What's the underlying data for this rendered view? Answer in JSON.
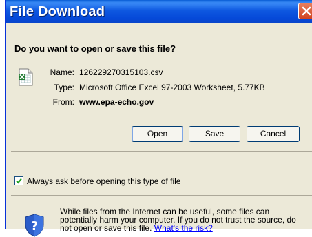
{
  "window": {
    "title": "File Download"
  },
  "prompt": "Do you want to open or save this file?",
  "file": {
    "icon": "excel-csv-file-icon",
    "name_label": "Name:",
    "name": "126229270315103.csv",
    "type_label": "Type:",
    "type": "Microsoft Office Excel 97-2003 Worksheet, 5.77KB",
    "from_label": "From:",
    "from": "www.epa-echo.gov"
  },
  "buttons": {
    "open": "Open",
    "save": "Save",
    "cancel": "Cancel"
  },
  "always_ask": {
    "label": "Always ask before opening this type of file",
    "checked": true
  },
  "warning": {
    "text": "While files from the Internet can be useful, some files can potentially harm your computer. If you do not trust the source, do not open or save this file.",
    "link": "What's the risk?"
  },
  "colors": {
    "titlebar": "#0548d8",
    "dialog_bg": "#ece9d8",
    "link": "#0000ff"
  }
}
